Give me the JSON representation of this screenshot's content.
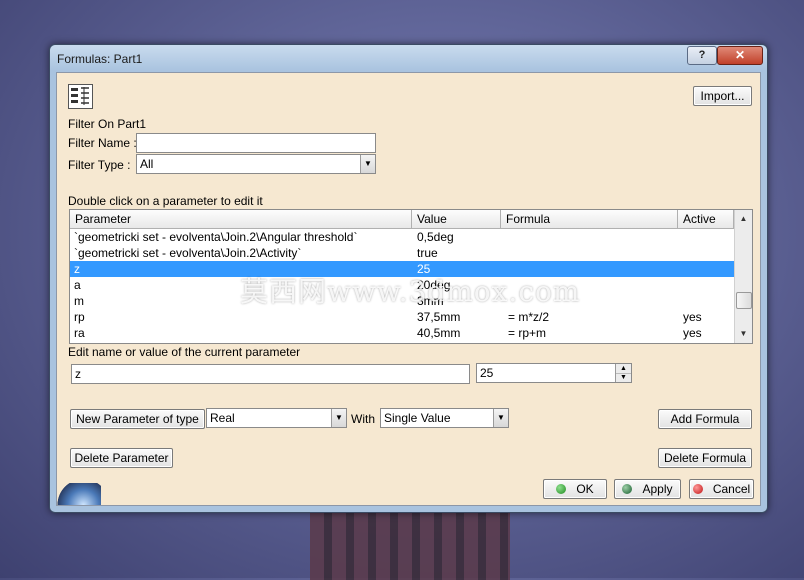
{
  "window": {
    "title": "Formulas: Part1",
    "help_label": "?",
    "close_label": "✕"
  },
  "toolbar": {
    "import_label": "Import..."
  },
  "filter": {
    "section_label": "Filter On Part1",
    "name_label": "Filter Name :",
    "name_value": "",
    "type_label": "Filter Type :",
    "type_value": "All"
  },
  "table": {
    "caption": "Double click on a parameter to edit it",
    "columns": [
      "Parameter",
      "Value",
      "Formula",
      "Active"
    ],
    "rows": [
      {
        "parameter": "`geometricki set - evolventa\\Join.2\\Angular threshold`",
        "value": "0,5deg",
        "formula": "",
        "active": ""
      },
      {
        "parameter": "`geometricki set - evolventa\\Join.2\\Activity`",
        "value": "true",
        "formula": "",
        "active": ""
      },
      {
        "parameter": "z",
        "value": "25",
        "formula": "",
        "active": ""
      },
      {
        "parameter": "a",
        "value": "20deg",
        "formula": "",
        "active": ""
      },
      {
        "parameter": "m",
        "value": "3mm",
        "formula": "",
        "active": ""
      },
      {
        "parameter": "rp",
        "value": "37,5mm",
        "formula": "= m*z/2",
        "active": "yes"
      },
      {
        "parameter": "ra",
        "value": "40,5mm",
        "formula": "= rp+m",
        "active": "yes"
      }
    ]
  },
  "edit": {
    "label": "Edit name or value of the current parameter",
    "name_value": "z",
    "value_value": "25"
  },
  "new_param": {
    "button_label": "New Parameter of type",
    "type_value": "Real",
    "with_label": "With",
    "with_value": "Single Value"
  },
  "actions": {
    "add_formula": "Add Formula",
    "delete_parameter": "Delete Parameter",
    "delete_formula": "Delete Formula",
    "ok": "OK",
    "apply": "Apply",
    "cancel": "Cancel"
  },
  "watermark": "莫西网www.3dmox.com",
  "colors": {
    "selection": "#3399ff",
    "client_bg": "#f6e8d1",
    "ok_dot": "#2a9a2a",
    "apply_dot": "#1f6f3a",
    "cancel_dot": "#d02020"
  }
}
